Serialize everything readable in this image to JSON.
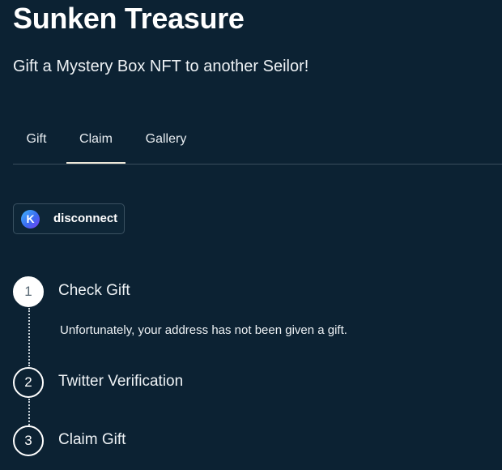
{
  "header": {
    "title": "Sunken Treasure",
    "subtitle": "Gift a Mystery Box NFT to another Seilor!"
  },
  "tabs": [
    {
      "label": "Gift",
      "active": false
    },
    {
      "label": "Claim",
      "active": true
    },
    {
      "label": "Gallery",
      "active": false
    }
  ],
  "wallet": {
    "icon_letter": "K",
    "icon": "keplr-wallet-icon",
    "label": "disconnect"
  },
  "steps": [
    {
      "number": "1",
      "label": "Check Gift",
      "active": true,
      "message": "Unfortunately, your address has not been given a gift."
    },
    {
      "number": "2",
      "label": "Twitter Verification",
      "active": false
    },
    {
      "number": "3",
      "label": "Claim Gift",
      "active": false
    }
  ],
  "colors": {
    "background": "#0c2233",
    "text": "#ffffff",
    "tab_underline": "#ece7d9",
    "divider": "#3a4d5c"
  }
}
